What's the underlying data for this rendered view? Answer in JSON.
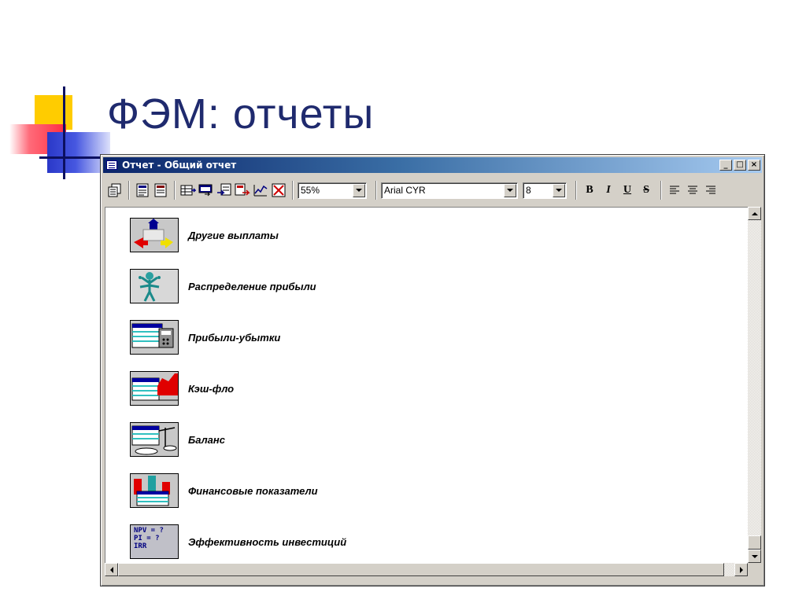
{
  "slide": {
    "title": "ФЭМ: отчеты"
  },
  "window": {
    "title": "Отчет - Общий отчет",
    "controls": {
      "minimize": "_",
      "maximize": "□",
      "close": "×"
    }
  },
  "toolbar": {
    "zoom": "55%",
    "font": "Arial CYR",
    "font_size": "8",
    "bold": "B",
    "italic": "I",
    "underline": "U",
    "strikethrough": "S"
  },
  "reports": [
    {
      "label": "Другие выплаты",
      "icon": "other-payments-icon"
    },
    {
      "label": "Распределение прибыли",
      "icon": "profit-distribution-icon"
    },
    {
      "label": "Прибыли-убытки",
      "icon": "profit-loss-icon"
    },
    {
      "label": "Кэш-фло",
      "icon": "cash-flow-icon"
    },
    {
      "label": "Баланс",
      "icon": "balance-icon"
    },
    {
      "label": "Финансовые показатели",
      "icon": "financial-indicators-icon"
    },
    {
      "label": "Эффективность инвестиций",
      "icon": "investment-efficiency-icon"
    }
  ],
  "npv_thumb": {
    "line1": "NPV = ?",
    "line2": "PI = ?",
    "line3": "IRR"
  },
  "colors": {
    "title_text": "#1f2a6e",
    "titlebar_start": "#0a246a",
    "titlebar_end": "#a6caf0",
    "window_face": "#d4d0c8",
    "deco_yellow": "#ffcc00",
    "deco_red": "#ff2d40",
    "deco_blue": "#2a38c8"
  }
}
